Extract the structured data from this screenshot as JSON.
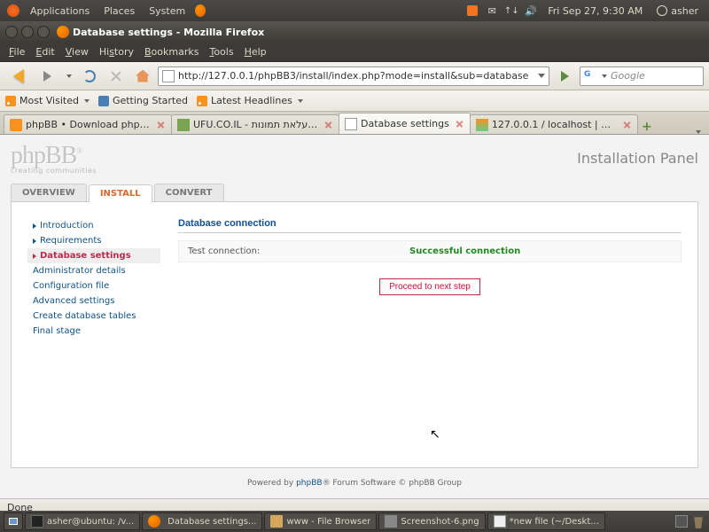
{
  "top_panel": {
    "menus": [
      "Applications",
      "Places",
      "System"
    ],
    "datetime": "Fri Sep 27,  9:30 AM",
    "user": "asher"
  },
  "window": {
    "title": "Database settings - Mozilla Firefox"
  },
  "menubar": [
    "File",
    "Edit",
    "View",
    "History",
    "Bookmarks",
    "Tools",
    "Help"
  ],
  "url": "http://127.0.0.1/phpBB3/install/index.php?mode=install&sub=database",
  "search_placeholder": "Google",
  "bookmarks": [
    {
      "label": "Most Visited",
      "dropdown": true
    },
    {
      "label": "Getting Started",
      "dropdown": false
    },
    {
      "label": "Latest Headlines",
      "dropdown": true
    }
  ],
  "tabs": [
    {
      "label": "phpBB • Download phpBB3",
      "active": false
    },
    {
      "label": "UFU.CO.IL - העלאת תמונות ...",
      "active": false
    },
    {
      "label": "Database settings",
      "active": true
    },
    {
      "label": "127.0.0.1 / localhost | php...",
      "active": false
    }
  ],
  "phpbb": {
    "logo": "phpBB",
    "tagline": "creating communities",
    "panel_title": "Installation Panel",
    "tabs": [
      {
        "label": "OVERVIEW",
        "active": false
      },
      {
        "label": "INSTALL",
        "active": true
      },
      {
        "label": "CONVERT",
        "active": false
      }
    ],
    "nav": [
      {
        "label": "Introduction",
        "active": false
      },
      {
        "label": "Requirements",
        "active": false
      },
      {
        "label": "Database settings",
        "active": true
      },
      {
        "label": "Administrator details",
        "active": false
      },
      {
        "label": "Configuration file",
        "active": false
      },
      {
        "label": "Advanced settings",
        "active": false
      },
      {
        "label": "Create database tables",
        "active": false
      },
      {
        "label": "Final stage",
        "active": false
      }
    ],
    "section_title": "Database connection",
    "test_label": "Test connection:",
    "test_result": "Successful connection",
    "proceed": "Proceed to next step",
    "footer_prefix": "Powered by ",
    "footer_link": "phpBB",
    "footer_suffix": "® Forum Software © phpBB Group"
  },
  "status_bar": "Done",
  "taskbar": [
    {
      "label": "asher@ubuntu: /v..."
    },
    {
      "label": "Database settings..."
    },
    {
      "label": "www - File Browser"
    },
    {
      "label": "Screenshot-6.png"
    },
    {
      "label": "*new file (~/Deskt..."
    }
  ]
}
